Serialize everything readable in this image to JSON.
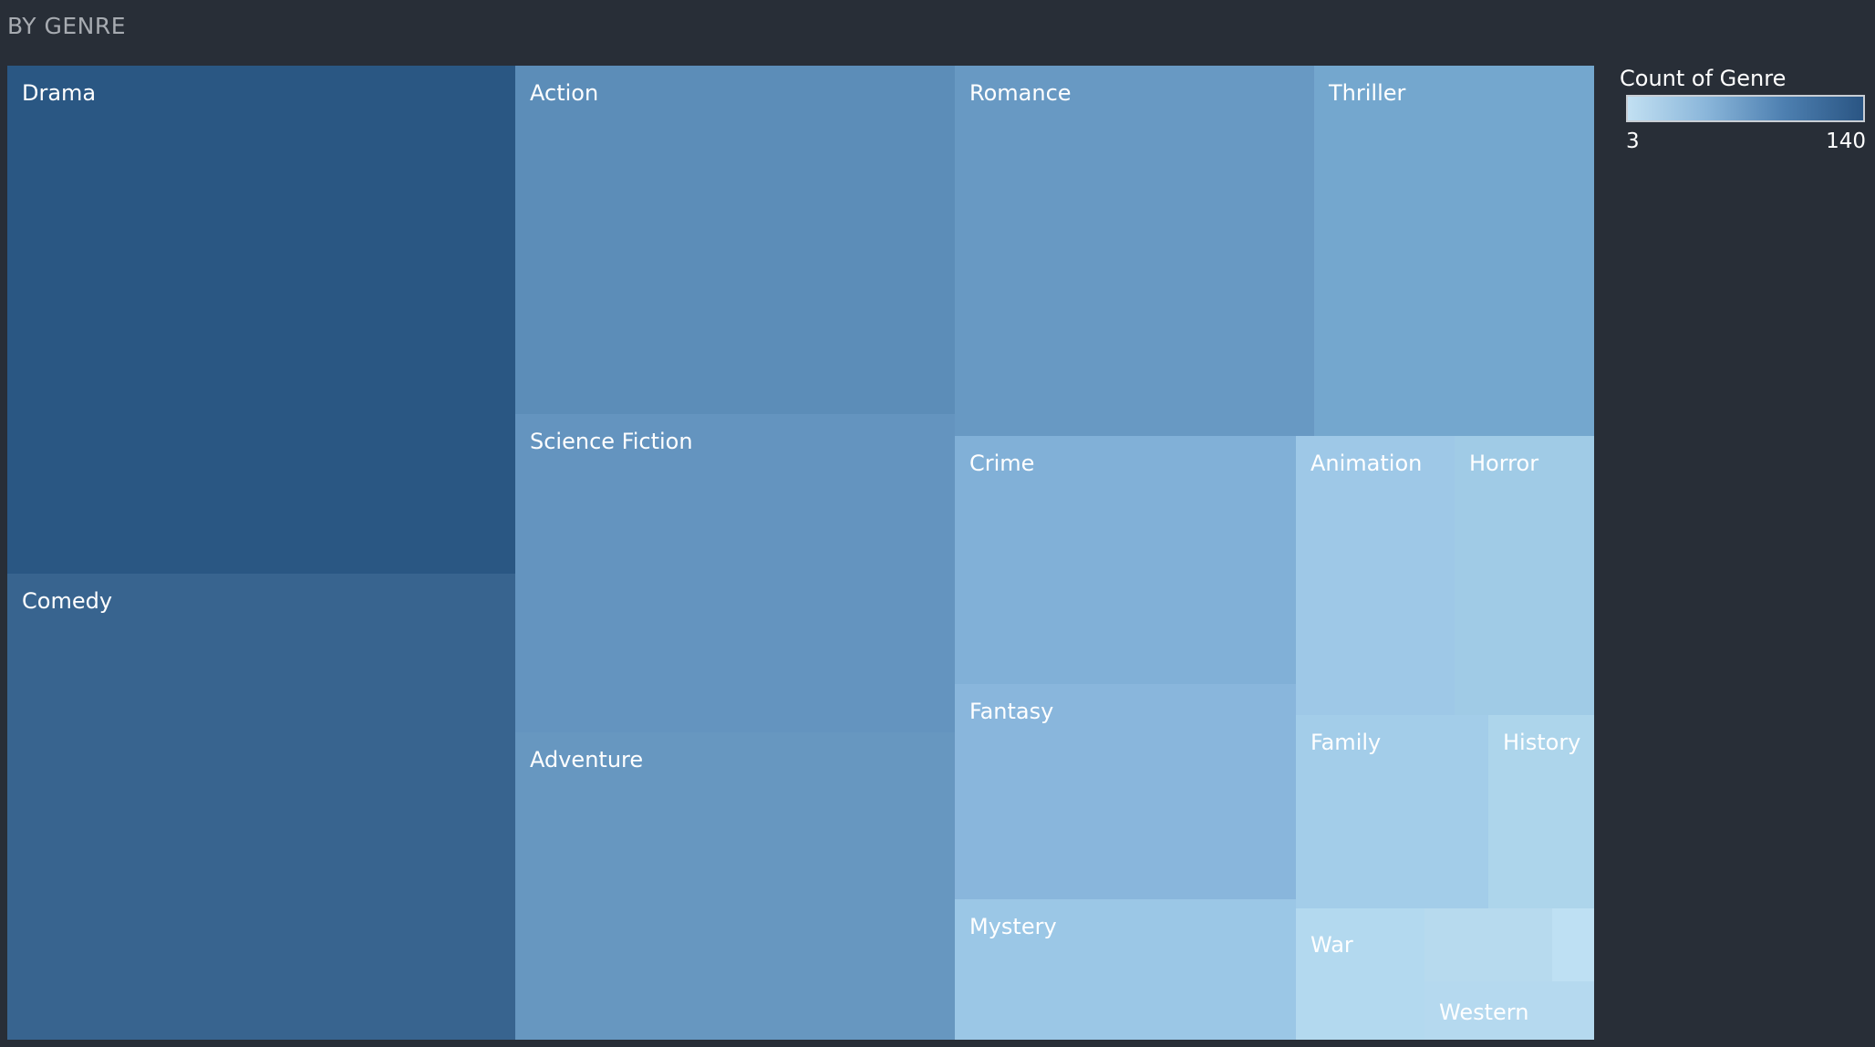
{
  "title": "BY GENRE",
  "legend": {
    "title": "Count of Genre",
    "min_label": "3",
    "max_label": "140",
    "colors": [
      "#c2e0f2",
      "#8ab6da",
      "#4d7fb0",
      "#2a5583"
    ]
  },
  "chart_data": {
    "type": "treemap",
    "title": "BY GENRE",
    "color_metric": "Count of Genre",
    "color_range": [
      3,
      140
    ],
    "items": [
      {
        "label": "Drama",
        "value": 140,
        "color": "#2a5783"
      },
      {
        "label": "Comedy",
        "value": 127,
        "color": "#38648f"
      },
      {
        "label": "Action",
        "value": 82,
        "color": "#5c8db8"
      },
      {
        "label": "Science Fiction",
        "value": 75,
        "color": "#6494bf"
      },
      {
        "label": "Adventure",
        "value": 72,
        "color": "#6797c0"
      },
      {
        "label": "Romance",
        "value": 72,
        "color": "#6899c3"
      },
      {
        "label": "Thriller",
        "value": 56,
        "color": "#74a7ce"
      },
      {
        "label": "Crime",
        "value": 46,
        "color": "#81b0d7"
      },
      {
        "label": "Fantasy",
        "value": 40,
        "color": "#89b6dc"
      },
      {
        "label": "Mystery",
        "value": 26,
        "color": "#9bc7e6"
      },
      {
        "label": "Animation",
        "value": 24,
        "color": "#9ec8e7"
      },
      {
        "label": "Horror",
        "value": 21,
        "color": "#a0cbe6"
      },
      {
        "label": "Family",
        "value": 19,
        "color": "#a3cde9"
      },
      {
        "label": "History",
        "value": 11,
        "color": "#add5eb"
      },
      {
        "label": "War",
        "value": 10,
        "color": "#b3d9ef"
      },
      {
        "label": "",
        "value": 5,
        "color": "#b7daee"
      },
      {
        "label": "Western",
        "value": 7,
        "color": "#b5d9ef"
      },
      {
        "label": "",
        "value": 3,
        "color": "#bee0f3"
      }
    ]
  }
}
